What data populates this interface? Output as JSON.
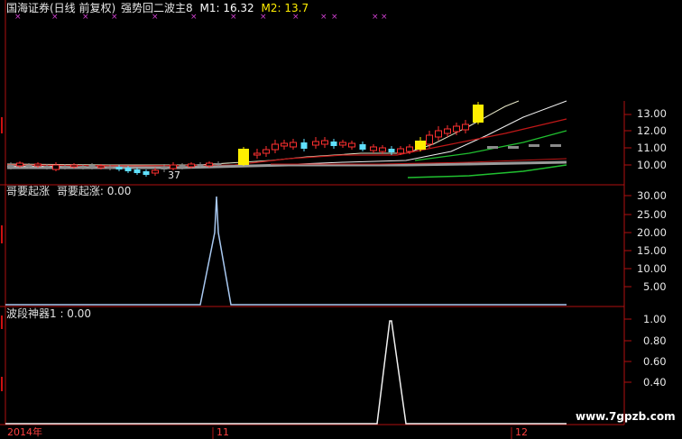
{
  "header": {
    "title": "国海证券(日线 前复权)",
    "indicator": "强势回二波主8",
    "m1": "M1: 16.32",
    "m2": "M2: 13.7"
  },
  "price_panel": {
    "y_ticks": [
      "13.00",
      "12.00",
      "11.00",
      "10.00"
    ],
    "annotation": "37",
    "colors": {
      "up": "#ff3030",
      "down": "#60e0ff",
      "highlight": "#ffee00",
      "ma_white": "#f0f0f0",
      "ma_red": "#c01818",
      "ma_green": "#20c030"
    }
  },
  "panel2": {
    "title": "哥要起涨",
    "value_label": "哥要起涨: 0.00",
    "y_ticks": [
      "30.00",
      "25.00",
      "20.00",
      "15.00",
      "10.00",
      "5.00"
    ]
  },
  "panel3": {
    "value_label": "波段神器1 : 0.00",
    "y_ticks": [
      "1.00",
      "0.80",
      "0.60",
      "0.40"
    ]
  },
  "x_axis": {
    "labels": [
      "2014年",
      "11",
      "12"
    ]
  },
  "watermark": "www.7gpzb.com"
}
